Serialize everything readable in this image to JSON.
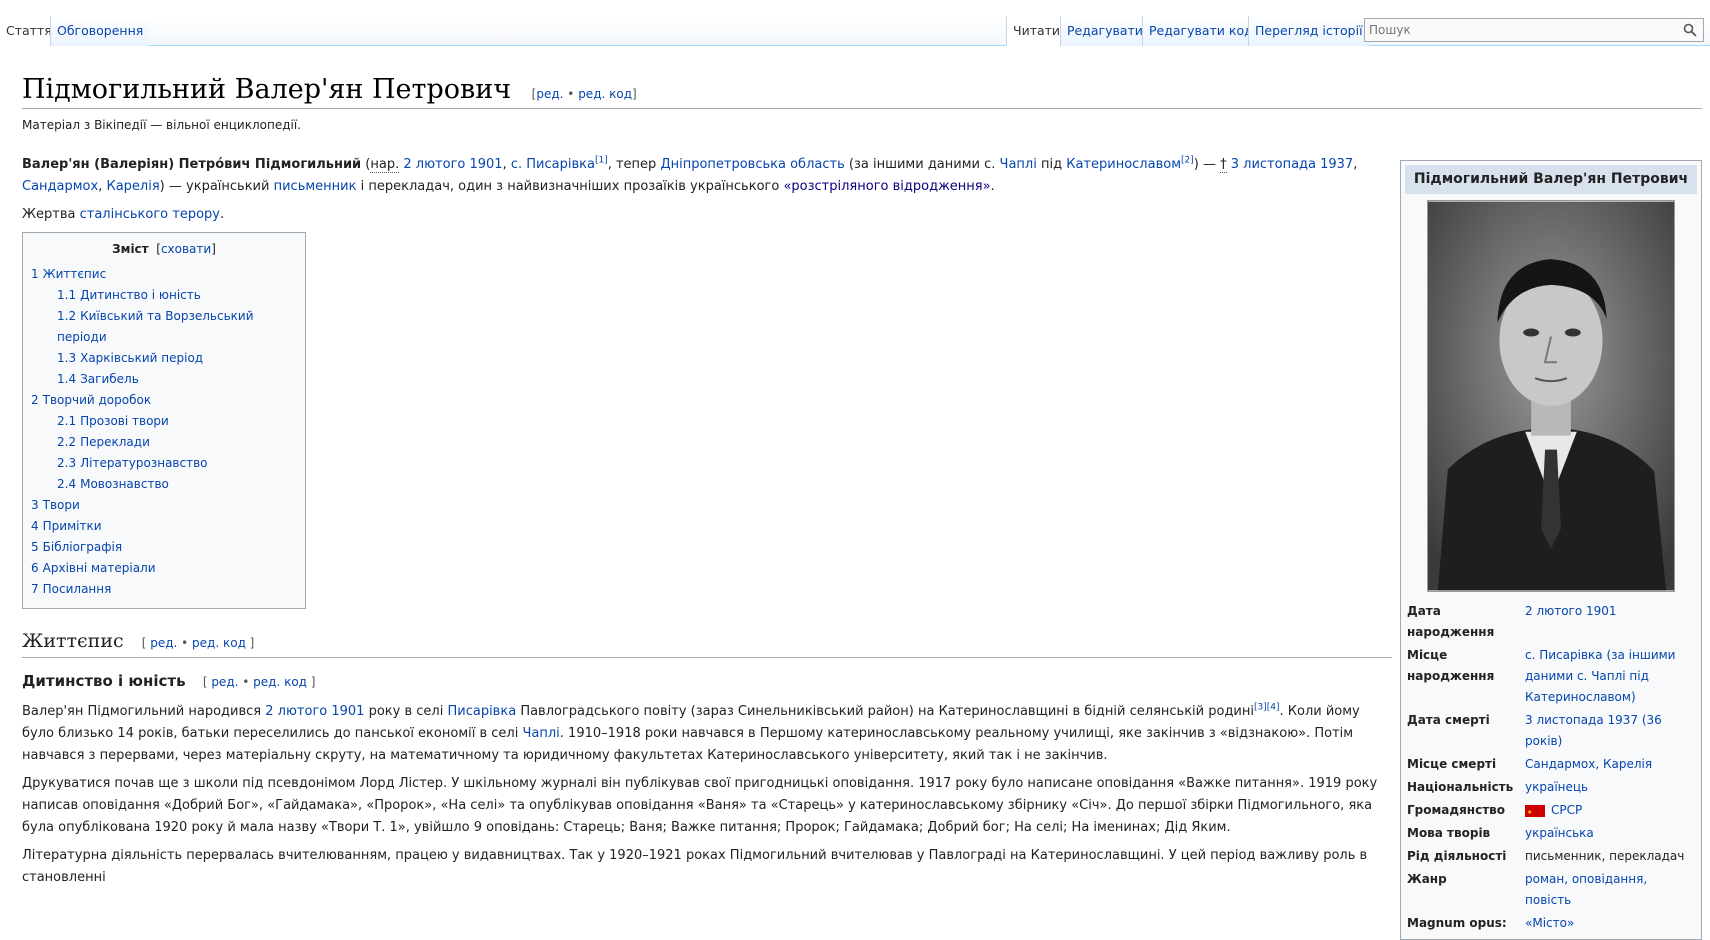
{
  "tabs_left": [
    "Стаття",
    "Обговорення"
  ],
  "tabs_right": [
    "Читати",
    "Редагувати",
    "Редагувати код",
    "Перегляд історії"
  ],
  "search": {
    "placeholder": "Пошук"
  },
  "page": {
    "title": "Підмогильний Валер'ян Петрович",
    "edit": "ред.",
    "edit_code": "ред. код",
    "tagline": "Матеріал з Вікіпедії — вільної енциклопедії."
  },
  "intro": {
    "name": "Валер'ян (Валеріян) Петро́вич Підмогильний",
    "born_abbr": "нар.",
    "born_date": "2 лютого 1901",
    "born_village_prefix": "с.",
    "born_village": "Писарівка",
    "ref1": "[1]",
    "now_text": "теper",
    "oblast": "Дніпропетровська область",
    "alt_text": "(за іншими даними с.",
    "chapli": "Чаплі",
    "under": "під",
    "katerynoslav": "Катеринославом",
    "ref2": "[2]",
    "death_date": "3 листопада 1937",
    "sandarmokh": "Сандармох",
    "karelia": "Карелія",
    "rest_a": "— український",
    "writer": "письменник",
    "rest_b": "і перекладач, один з найвизначніших прозаїків українського",
    "renaissance": "«розстріляного відродження»",
    "victim_text": "Жертва",
    "terror": "сталінського терору"
  },
  "toc": {
    "title": "Зміст",
    "hide": "сховати",
    "items": [
      {
        "num": "1",
        "label": "Життєпис",
        "level": 1
      },
      {
        "num": "1.1",
        "label": "Дитинство і юність",
        "level": 2
      },
      {
        "num": "1.2",
        "label": "Київський та Ворзельський періоди",
        "level": 2
      },
      {
        "num": "1.3",
        "label": "Харківський період",
        "level": 2
      },
      {
        "num": "1.4",
        "label": "Загибель",
        "level": 2
      },
      {
        "num": "2",
        "label": "Творчий доробок",
        "level": 1
      },
      {
        "num": "2.1",
        "label": "Прозові твори",
        "level": 2
      },
      {
        "num": "2.2",
        "label": "Переклади",
        "level": 2
      },
      {
        "num": "2.3",
        "label": "Літературознавство",
        "level": 2
      },
      {
        "num": "2.4",
        "label": "Мовознавство",
        "level": 2
      },
      {
        "num": "3",
        "label": "Твори",
        "level": 1
      },
      {
        "num": "4",
        "label": "Примітки",
        "level": 1
      },
      {
        "num": "5",
        "label": "Бібліографія",
        "level": 1
      },
      {
        "num": "6",
        "label": "Архівні матеріали",
        "level": 1
      },
      {
        "num": "7",
        "label": "Посилання",
        "level": 1
      }
    ]
  },
  "section1": {
    "title": "Життєпис",
    "sub_title": "Дитинство і юність",
    "p1_a": "Валер'ян Підмогильний народився",
    "p1_date": "2 лютого 1901",
    "p1_b": "року в селі",
    "p1_village": "Писарівка",
    "p1_c": "Павлоградського повіту (зараз Синельниківський район) на Катеринославщині в бідній селянській родині",
    "p1_refs": "[3][4]",
    "p1_d": ". Коли йому було близько 14 років, батьки переселились до панської економії в селі",
    "p1_chapli": "Чаплі",
    "p1_e": ". 1910–1918 роки навчався в Першому катеринославському реальному училищі, яке закінчив з «відзнакою». Потім навчався з перервами, через матеріальну скруту, на математичному та юридичному факультетах Катеринославського університету, який так і не закінчив.",
    "p2": "Друкуватися почав ще з школи під псевдонімом Лорд Лістер. У шкільному журналі він публікував свої пригодницькі оповідання. 1917 року було написане оповідання «Важке питання». 1919 року написав оповідання «Добрий Бог», «Гайдамака», «Пророк», «На селі» та опублікував оповідання «Ваня» та «Старець» у катеринославському збірнику «Січ». До першої збірки Підмогильного, яка була опублікована 1920 року й мала назву «Твори Т. 1», увійшло 9 оповідань: Старець; Ваня; Важке питання; Пророк; Гайдамака; Добрий бог; На селі; На іменинах; Дід Яким.",
    "p3": "Літературна діяльність перервалась вчителюванням, працею у видавництвах. Так у 1920–1921 роках Підмогильний вчителював у Павлограді на Катеринославщині. У цей період важливу роль в становленні"
  },
  "infobox": {
    "title": "Підмогильний Валер'ян Петрович",
    "rows": [
      {
        "label": "Дата народження",
        "value": "2 лютого 1901"
      },
      {
        "label": "Місце народження",
        "value": "с. Писарівка (за іншими даними с. Чаплі під Катеринославом)"
      },
      {
        "label": "Дата смерті",
        "value": "3 листопада 1937 (36 років)"
      },
      {
        "label": "Місце смерті",
        "value": "Сандармох, Карелія"
      },
      {
        "label": "Національність",
        "value": "українець"
      },
      {
        "label": "Громадянство",
        "value": "СРСР"
      },
      {
        "label": "Мова творів",
        "value": "українська"
      },
      {
        "label": "Рід діяльності",
        "value": "письменник, перекладач"
      },
      {
        "label": "Жанр",
        "value": "роман, оповідання, повість"
      },
      {
        "label": "Magnum opus:",
        "value": "«Місто»"
      }
    ]
  }
}
